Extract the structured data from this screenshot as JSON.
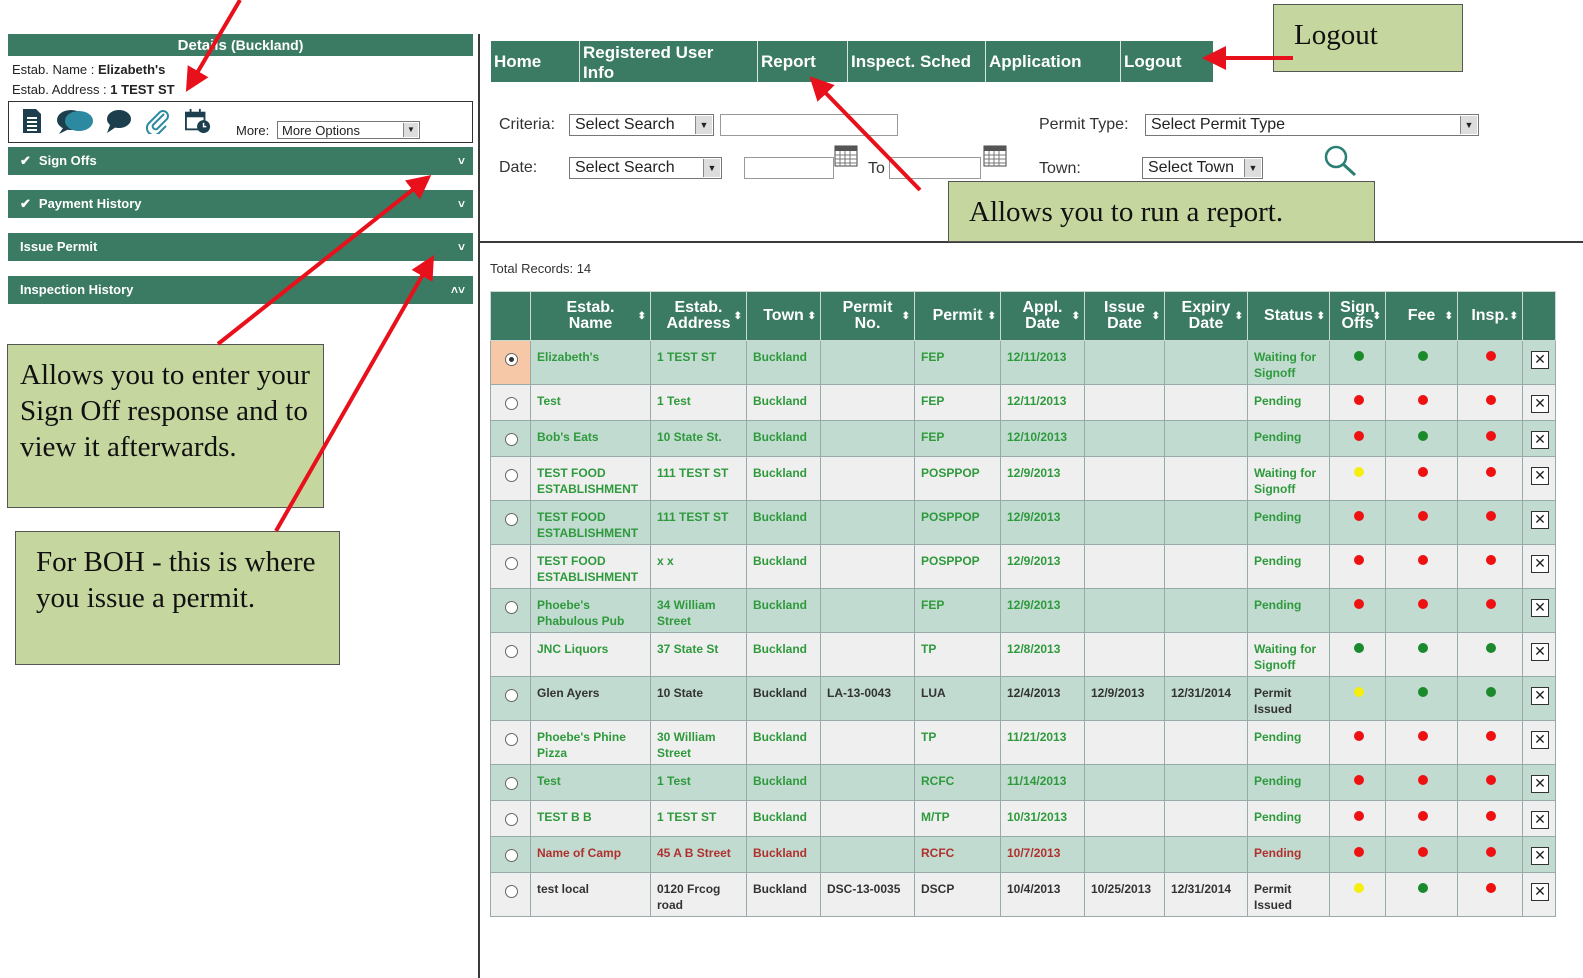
{
  "details": {
    "title": "Details",
    "town": "(Buckland)",
    "name_label": "Estab. Name : ",
    "name_value": "Elizabeth's",
    "address_label": "Estab. Address : ",
    "address_value": "1 TEST ST",
    "toolbar_icons": [
      "document-icon",
      "chat-bubbles-icon",
      "comment-icon",
      "paperclip-icon",
      "calendar-clock-icon"
    ],
    "more_label": "More:",
    "more_value": "More Options"
  },
  "accordion": [
    {
      "label": "Sign Offs",
      "checked": true,
      "chevron": "˅"
    },
    {
      "label": "Payment History",
      "checked": true,
      "chevron": "˅"
    },
    {
      "label": "Issue Permit",
      "checked": false,
      "chevron": "˅"
    },
    {
      "label": "Inspection History",
      "checked": false,
      "chevron": "˄˅"
    }
  ],
  "nav": {
    "home": "Home",
    "registered_line1": "Registered User",
    "registered_line2": "Info",
    "report": "Report",
    "inspect": "Inspect. Sched",
    "application": "Application",
    "logout": "Logout"
  },
  "search": {
    "criteria_label": "Criteria:",
    "criteria_value": "Select Search",
    "date_label": "Date:",
    "date_value": "Select Search",
    "to_label": "To",
    "permit_type_label": "Permit Type:",
    "permit_type_value": "Select Permit Type",
    "town_label": "Town:",
    "town_value": "Select Town"
  },
  "records_label": "Total Records: 14",
  "table": {
    "headers": [
      {
        "l1": "Estab.",
        "l2": "Name"
      },
      {
        "l1": "Estab.",
        "l2": "Address"
      },
      {
        "l1": "Town",
        "l2": ""
      },
      {
        "l1": "Permit",
        "l2": "No."
      },
      {
        "l1": "Permit",
        "l2": ""
      },
      {
        "l1": "Appl.",
        "l2": "Date"
      },
      {
        "l1": "Issue",
        "l2": "Date"
      },
      {
        "l1": "Expiry",
        "l2": "Date"
      },
      {
        "l1": "Status",
        "l2": ""
      },
      {
        "l1": "Sign",
        "l2": "Offs"
      },
      {
        "l1": "Fee",
        "l2": ""
      },
      {
        "l1": "Insp.",
        "l2": ""
      }
    ],
    "rows": [
      {
        "name": "Elizabeth's",
        "address": "1 TEST ST",
        "town": "Buckland",
        "permit_no": "",
        "permit": "FEP",
        "appl": "12/11/2013",
        "issue": "",
        "expiry": "",
        "status": "Waiting for Signoff",
        "sign": "green",
        "fee": "green",
        "insp": "red",
        "color": "g",
        "selected": true
      },
      {
        "name": "Test",
        "address": "1 Test",
        "town": "Buckland",
        "permit_no": "",
        "permit": "FEP",
        "appl": "12/11/2013",
        "issue": "",
        "expiry": "",
        "status": "Pending",
        "sign": "red",
        "fee": "red",
        "insp": "red",
        "color": "g",
        "selected": false
      },
      {
        "name": "Bob's Eats",
        "address": "10 State St.",
        "town": "Buckland",
        "permit_no": "",
        "permit": "FEP",
        "appl": "12/10/2013",
        "issue": "",
        "expiry": "",
        "status": "Pending",
        "sign": "red",
        "fee": "green",
        "insp": "red",
        "color": "g",
        "selected": false
      },
      {
        "name": "TEST FOOD ESTABLISHMENT",
        "address": "111 TEST ST",
        "town": "Buckland",
        "permit_no": "",
        "permit": "POSPPOP",
        "appl": "12/9/2013",
        "issue": "",
        "expiry": "",
        "status": "Waiting for Signoff",
        "sign": "yellow",
        "fee": "red",
        "insp": "red",
        "color": "g",
        "selected": false
      },
      {
        "name": "TEST FOOD ESTABLISHMENT",
        "address": "111 TEST ST",
        "town": "Buckland",
        "permit_no": "",
        "permit": "POSPPOP",
        "appl": "12/9/2013",
        "issue": "",
        "expiry": "",
        "status": "Pending",
        "sign": "red",
        "fee": "red",
        "insp": "red",
        "color": "g",
        "selected": false
      },
      {
        "name": "TEST FOOD ESTABLISHMENT",
        "address": "x x",
        "town": "Buckland",
        "permit_no": "",
        "permit": "POSPPOP",
        "appl": "12/9/2013",
        "issue": "",
        "expiry": "",
        "status": "Pending",
        "sign": "red",
        "fee": "red",
        "insp": "red",
        "color": "g",
        "selected": false
      },
      {
        "name": "Phoebe's Phabulous Pub",
        "address": "34 William Street",
        "town": "Buckland",
        "permit_no": "",
        "permit": "FEP",
        "appl": "12/9/2013",
        "issue": "",
        "expiry": "",
        "status": "Pending",
        "sign": "red",
        "fee": "red",
        "insp": "red",
        "color": "g",
        "selected": false
      },
      {
        "name": "JNC Liquors",
        "address": "37 State St",
        "town": "Buckland",
        "permit_no": "",
        "permit": "TP",
        "appl": "12/8/2013",
        "issue": "",
        "expiry": "",
        "status": "Waiting for Signoff",
        "sign": "green",
        "fee": "green",
        "insp": "green",
        "color": "g",
        "selected": false
      },
      {
        "name": "Glen Ayers",
        "address": "10 State",
        "town": "Buckland",
        "permit_no": "LA-13-0043",
        "permit": "LUA",
        "appl": "12/4/2013",
        "issue": "12/9/2013",
        "expiry": "12/31/2014",
        "status": "Permit Issued",
        "sign": "yellow",
        "fee": "green",
        "insp": "green",
        "color": "k",
        "selected": false
      },
      {
        "name": "Phoebe's Phine Pizza",
        "address": "30 William Street",
        "town": "Buckland",
        "permit_no": "",
        "permit": "TP",
        "appl": "11/21/2013",
        "issue": "",
        "expiry": "",
        "status": "Pending",
        "sign": "red",
        "fee": "red",
        "insp": "red",
        "color": "g",
        "selected": false
      },
      {
        "name": "Test",
        "address": "1 Test",
        "town": "Buckland",
        "permit_no": "",
        "permit": "RCFC",
        "appl": "11/14/2013",
        "issue": "",
        "expiry": "",
        "status": "Pending",
        "sign": "red",
        "fee": "red",
        "insp": "red",
        "color": "g",
        "selected": false
      },
      {
        "name": "TEST B B",
        "address": "1 TEST ST",
        "town": "Buckland",
        "permit_no": "",
        "permit": "M/TP",
        "appl": "10/31/2013",
        "issue": "",
        "expiry": "",
        "status": "Pending",
        "sign": "red",
        "fee": "red",
        "insp": "red",
        "color": "g",
        "selected": false
      },
      {
        "name": "Name of Camp",
        "address": "45 A B Street",
        "town": "Buckland",
        "permit_no": "",
        "permit": "RCFC",
        "appl": "10/7/2013",
        "issue": "",
        "expiry": "",
        "status": "Pending",
        "sign": "red",
        "fee": "red",
        "insp": "red",
        "color": "r",
        "selected": false
      },
      {
        "name": "test local",
        "address": "0120 Frcog road",
        "town": "Buckland",
        "permit_no": "DSC-13-0035",
        "permit": "DSCP",
        "appl": "10/4/2013",
        "issue": "10/25/2013",
        "expiry": "12/31/2014",
        "status": "Permit Issued",
        "sign": "yellow",
        "fee": "green",
        "insp": "red",
        "color": "k",
        "selected": false
      }
    ]
  },
  "callouts": {
    "logout": "Logout",
    "report": "Allows you to run a report.",
    "signoff": "Allows you to enter your Sign Off response and to view it afterwards.",
    "boh": "For BOH - this is where you issue a permit."
  },
  "colors": {
    "header_green": "#3b7a63",
    "callout_bg": "#c6d69f",
    "arrow_red": "#e8101a",
    "dot_green": "#1a8a2a",
    "dot_red": "#ee1111",
    "dot_yellow": "#f5ee10"
  }
}
